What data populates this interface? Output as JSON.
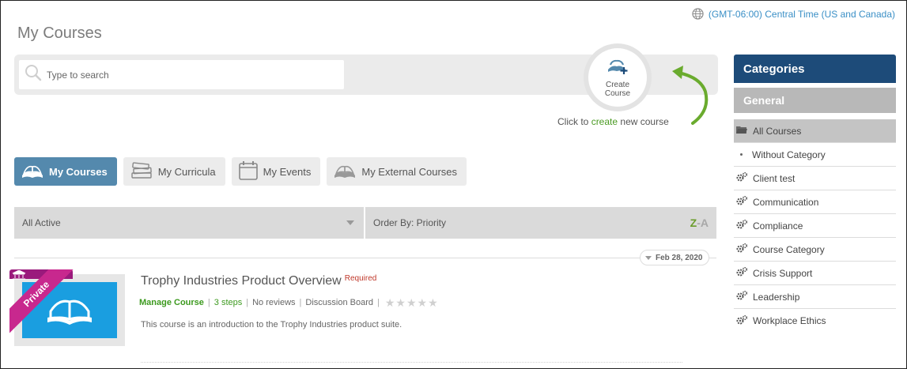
{
  "header": {
    "timezone": "(GMT-06:00) Central Time (US and Canada)",
    "page_title": "My Courses"
  },
  "search": {
    "placeholder": "Type to search"
  },
  "create": {
    "label": "Create Course",
    "hint_prefix": "Click to",
    "hint_link": "create",
    "hint_suffix": "new course"
  },
  "tabs": [
    {
      "label": "My Courses",
      "icon": "open-book-icon",
      "active": true
    },
    {
      "label": "My Curricula",
      "icon": "book-stack-icon",
      "active": false
    },
    {
      "label": "My Events",
      "icon": "calendar-icon",
      "active": false
    },
    {
      "label": "My External Courses",
      "icon": "open-book-icon",
      "active": false
    }
  ],
  "filters": {
    "status": "All Active",
    "order": "Order By: Priority",
    "sort_z": "Z",
    "sort_dash": "-",
    "sort_a": "A"
  },
  "date_tag": "Feb 28, 2020",
  "course": {
    "ribbon": "Private",
    "title": "Trophy Industries Product Overview",
    "required": "Required",
    "manage": "Manage Course",
    "steps": "3 steps",
    "reviews": "No reviews",
    "discussion": "Discussion Board",
    "rating": 0,
    "max_rating": 5,
    "description": "This course is an introduction to the Trophy Industries product suite."
  },
  "categories": {
    "header": "Categories",
    "group": "General",
    "items": [
      {
        "label": "All Courses",
        "icon": "folder-icon",
        "active": true
      },
      {
        "label": "Without Category",
        "icon": "bullet",
        "active": false
      },
      {
        "label": "Client test",
        "icon": "gears-icon",
        "active": false
      },
      {
        "label": "Communication",
        "icon": "gears-icon",
        "active": false
      },
      {
        "label": "Compliance",
        "icon": "gears-icon",
        "active": false
      },
      {
        "label": "Course Category",
        "icon": "gears-icon",
        "active": false
      },
      {
        "label": "Crisis Support",
        "icon": "gears-icon",
        "active": false
      },
      {
        "label": "Leadership",
        "icon": "gears-icon",
        "active": false
      },
      {
        "label": "Workplace Ethics",
        "icon": "gears-icon",
        "active": false
      }
    ]
  },
  "colors": {
    "accent_blue": "#5489ad",
    "category_header": "#1d4b79",
    "green": "#3d9a1f",
    "link_blue": "#3a8fc6",
    "ribbon": "#c8288e",
    "thumb": "#1a9ee0"
  }
}
